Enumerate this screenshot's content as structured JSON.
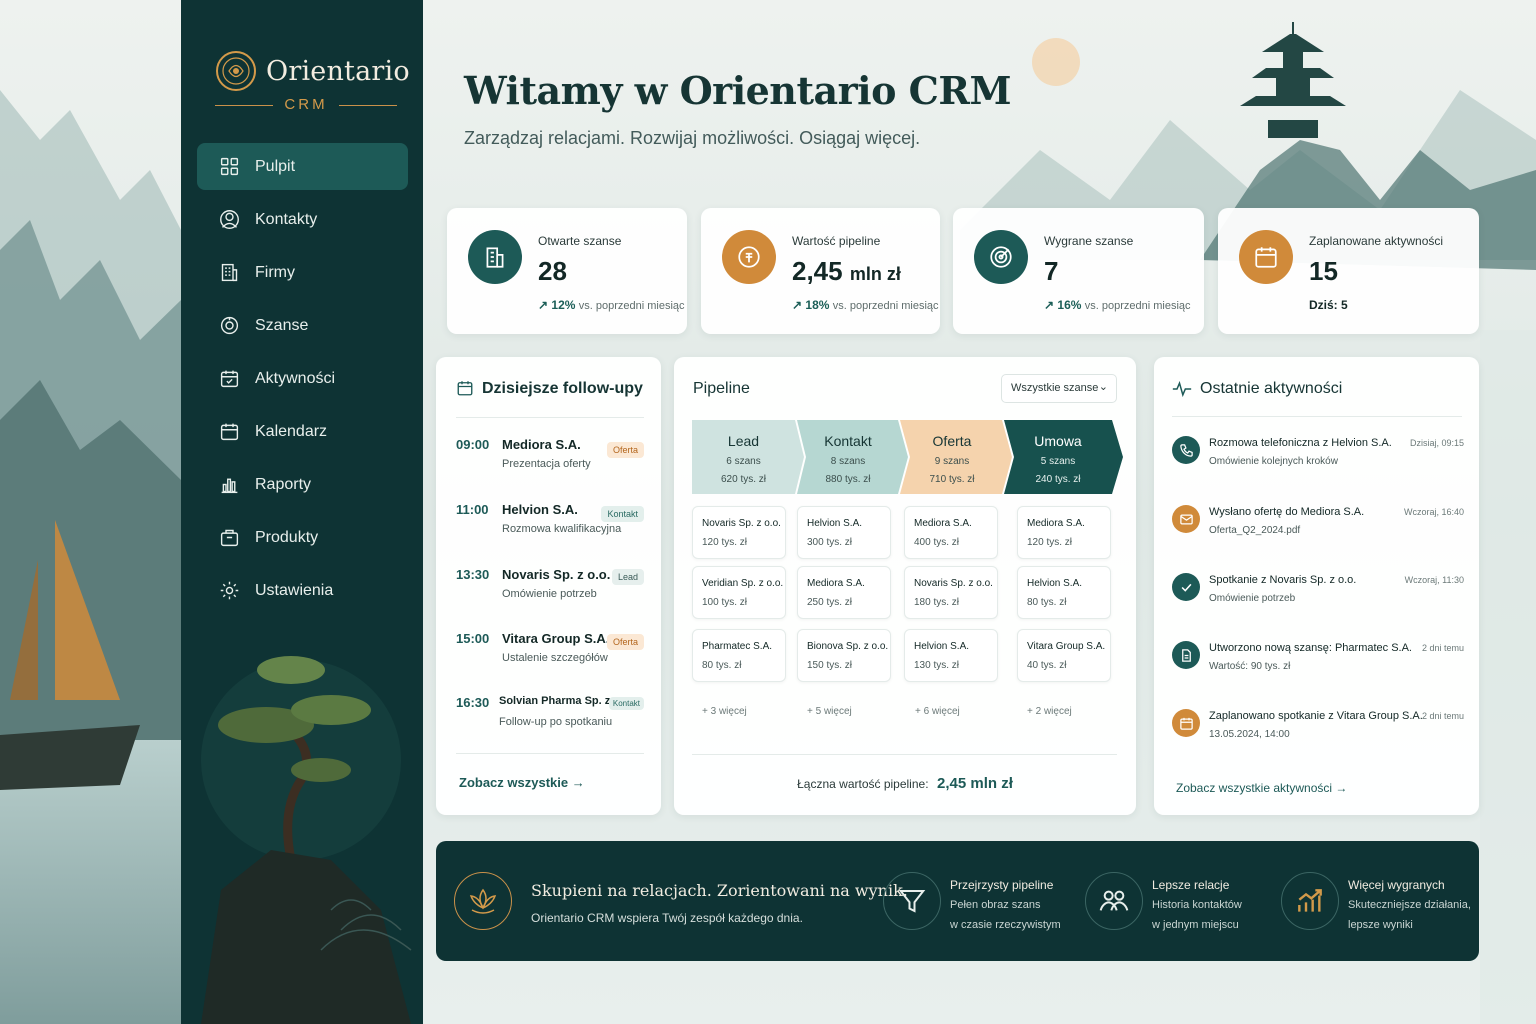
{
  "colors": {
    "primary": "#0e3334",
    "accent": "#d08a3a",
    "teal": "#1d5a57"
  },
  "brand": {
    "name": "Orientario",
    "sub": "CRM"
  },
  "nav": [
    {
      "label": "Pulpit",
      "icon": "grid-icon"
    },
    {
      "label": "Kontakty",
      "icon": "contacts-icon"
    },
    {
      "label": "Firmy",
      "icon": "building-icon"
    },
    {
      "label": "Szanse",
      "icon": "opportunity-icon"
    },
    {
      "label": "Aktywności",
      "icon": "calendar-check-icon"
    },
    {
      "label": "Kalendarz",
      "icon": "calendar-icon"
    },
    {
      "label": "Raporty",
      "icon": "chart-icon"
    },
    {
      "label": "Produkty",
      "icon": "box-icon"
    },
    {
      "label": "Ustawienia",
      "icon": "gear-icon"
    }
  ],
  "header": {
    "title": "Witamy w Orientario CRM",
    "subtitle": "Zarządzaj relacjami. Rozwijaj możliwości. Osiągaj więcej."
  },
  "stats": [
    {
      "label": "Otwarte szanse",
      "value": "28",
      "unit": "",
      "trend": "12%",
      "trend_text": "vs. poprzedni miesiąc"
    },
    {
      "label": "Wartość pipeline",
      "value": "2,45",
      "unit": "mln zł",
      "trend": "18%",
      "trend_text": "vs. poprzedni miesiąc"
    },
    {
      "label": "Wygrane szanse",
      "value": "7",
      "unit": "",
      "trend": "16%",
      "trend_text": "vs. poprzedni miesiąc"
    },
    {
      "label": "Zaplanowane aktywności",
      "value": "15",
      "unit": "",
      "today": "Dziś: 5"
    }
  ],
  "followups": {
    "title": "Dzisiejsze follow-upy",
    "items": [
      {
        "time": "09:00",
        "name": "Mediora S.A.",
        "desc": "Prezentacja oferty",
        "tag": "Oferta"
      },
      {
        "time": "11:00",
        "name": "Helvion S.A.",
        "desc": "Rozmowa kwalifikacyjna",
        "tag": "Kontakt"
      },
      {
        "time": "13:30",
        "name": "Novaris Sp. z o.o.",
        "desc": "Omówienie potrzeb",
        "tag": "Lead"
      },
      {
        "time": "15:00",
        "name": "Vitara Group S.A.",
        "desc": "Ustalenie szczegółów",
        "tag": "Oferta"
      },
      {
        "time": "16:30",
        "name": "Solvian Pharma Sp. z o.o.",
        "desc": "Follow-up po spotkaniu",
        "tag": "Kontakt"
      }
    ],
    "link": "Zobacz wszystkie"
  },
  "pipeline": {
    "title": "Pipeline",
    "filter": "Wszystkie szanse",
    "stages": [
      {
        "name": "Lead",
        "count": "6 szans",
        "value": "620 tys. zł",
        "more": "+ 3 więcej",
        "deals": [
          {
            "n": "Novaris Sp. z o.o.",
            "v": "120 tys. zł"
          },
          {
            "n": "Veridian Sp. z o.o.",
            "v": "100 tys. zł"
          },
          {
            "n": "Pharmatec S.A.",
            "v": "80 tys. zł"
          }
        ]
      },
      {
        "name": "Kontakt",
        "count": "8 szans",
        "value": "880 tys. zł",
        "more": "+ 5 więcej",
        "deals": [
          {
            "n": "Helvion S.A.",
            "v": "300 tys. zł"
          },
          {
            "n": "Mediora S.A.",
            "v": "250 tys. zł"
          },
          {
            "n": "Bionova Sp. z o.o.",
            "v": "150 tys. zł"
          }
        ]
      },
      {
        "name": "Oferta",
        "count": "9 szans",
        "value": "710 tys. zł",
        "more": "+ 6 więcej",
        "deals": [
          {
            "n": "Mediora S.A.",
            "v": "400 tys. zł"
          },
          {
            "n": "Novaris Sp. z o.o.",
            "v": "180 tys. zł"
          },
          {
            "n": "Helvion S.A.",
            "v": "130 tys. zł"
          }
        ]
      },
      {
        "name": "Umowa",
        "count": "5 szans",
        "value": "240 tys. zł",
        "more": "+ 2 więcej",
        "deals": [
          {
            "n": "Mediora S.A.",
            "v": "120 tys. zł"
          },
          {
            "n": "Helvion S.A.",
            "v": "80 tys. zł"
          },
          {
            "n": "Vitara Group S.A.",
            "v": "40 tys. zł"
          }
        ]
      }
    ],
    "total_label": "Łączna wartość pipeline:",
    "total_value": "2,45 mln zł"
  },
  "activities": {
    "title": "Ostatnie aktywności",
    "items": [
      {
        "title": "Rozmowa telefoniczna z Helvion S.A.",
        "desc": "Omówienie kolejnych kroków",
        "time": "Dzisiaj, 09:15",
        "icon": "phone-icon"
      },
      {
        "title": "Wysłano ofertę do Mediora S.A.",
        "desc": "Oferta_Q2_2024.pdf",
        "time": "Wczoraj, 16:40",
        "icon": "mail-icon"
      },
      {
        "title": "Spotkanie z Novaris Sp. z o.o.",
        "desc": "Omówienie potrzeb",
        "time": "Wczoraj, 11:30",
        "icon": "check-icon"
      },
      {
        "title": "Utworzono nową szansę: Pharmatec S.A.",
        "desc": "Wartość: 90 tys. zł",
        "time": "2 dni temu",
        "icon": "document-icon"
      },
      {
        "title": "Zaplanowano spotkanie z Vitara Group S.A.",
        "desc": "13.05.2024, 14:00",
        "time": "2 dni temu",
        "icon": "calendar-icon"
      }
    ],
    "link": "Zobacz wszystkie aktywności"
  },
  "banner": {
    "title": "Skupieni na relacjach. Zorientowani na wynik.",
    "subtitle": "Orientario CRM wspiera Twój zespół każdego dnia.",
    "features": [
      {
        "title": "Przejrzysty pipeline",
        "line1": "Pełen obraz szans",
        "line2": "w czasie rzeczywistym"
      },
      {
        "title": "Lepsze relacje",
        "line1": "Historia kontaktów",
        "line2": "w jednym miejscu"
      },
      {
        "title": "Więcej wygranych",
        "line1": "Skuteczniejsze działania,",
        "line2": "lepsze wyniki"
      }
    ]
  }
}
